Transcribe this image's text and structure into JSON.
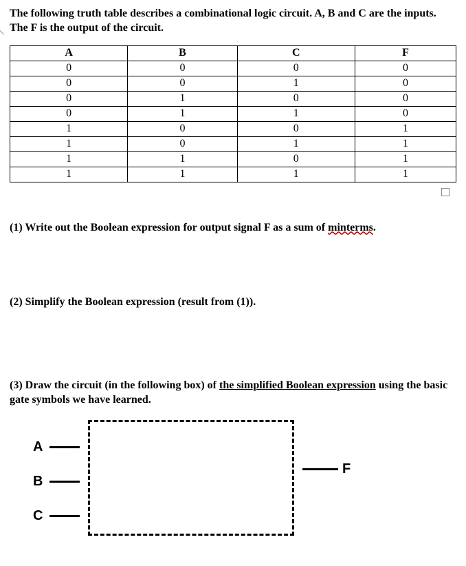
{
  "chart_data": {
    "type": "table",
    "columns": [
      "A",
      "B",
      "C",
      "F"
    ],
    "rows": [
      [
        0,
        0,
        0,
        0
      ],
      [
        0,
        0,
        1,
        0
      ],
      [
        0,
        1,
        0,
        0
      ],
      [
        0,
        1,
        1,
        0
      ],
      [
        1,
        0,
        0,
        1
      ],
      [
        1,
        0,
        1,
        1
      ],
      [
        1,
        1,
        0,
        1
      ],
      [
        1,
        1,
        1,
        1
      ]
    ]
  },
  "intro": "The following truth table describes a combinational logic circuit. A, B and C are the inputs. The F is the output of the circuit.",
  "table": {
    "headers": {
      "c0": "A",
      "c1": "B",
      "c2": "C",
      "c3": "F"
    },
    "r0": {
      "c0": "0",
      "c1": "0",
      "c2": "0",
      "c3": "0"
    },
    "r1": {
      "c0": "0",
      "c1": "0",
      "c2": "1",
      "c3": "0"
    },
    "r2": {
      "c0": "0",
      "c1": "1",
      "c2": "0",
      "c3": "0"
    },
    "r3": {
      "c0": "0",
      "c1": "1",
      "c2": "1",
      "c3": "0"
    },
    "r4": {
      "c0": "1",
      "c1": "0",
      "c2": "0",
      "c3": "1"
    },
    "r5": {
      "c0": "1",
      "c1": "0",
      "c2": "1",
      "c3": "1"
    },
    "r6": {
      "c0": "1",
      "c1": "1",
      "c2": "0",
      "c3": "1"
    },
    "r7": {
      "c0": "1",
      "c1": "1",
      "c2": "1",
      "c3": "1"
    }
  },
  "q1": {
    "prefix": "(1) Write out the Boolean expression for output signal F as a sum of ",
    "minterms": "minterms",
    "suffix": "."
  },
  "q2": "(2) Simplify the Boolean expression (result from (1)).",
  "q3": {
    "prefix": "(3) Draw the circuit (in the following box) of ",
    "underline": "the simplified Boolean expression",
    "suffix": " using the basic gate symbols we have learned."
  },
  "circuit": {
    "inputA": "A",
    "inputB": "B",
    "inputC": "C",
    "outputF": "F"
  }
}
